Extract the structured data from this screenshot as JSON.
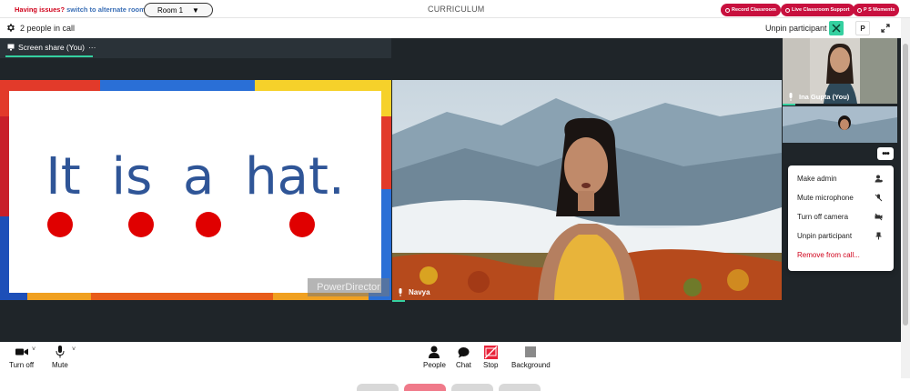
{
  "topbar": {
    "issues_text": "Having issues?",
    "alt_room_link": "switch to alternate room",
    "room_select_value": "Room 1",
    "title": "CURRICULUM",
    "buttons": [
      "Record Classroom",
      "Live Classroom Support",
      "P S Moments"
    ]
  },
  "callbar": {
    "people_count": "2 people in call",
    "unpin_label": "Unpin participant",
    "p_button": "P"
  },
  "screen_share": {
    "tab_label": "Screen share (You)",
    "tab_more": "···",
    "slide_text": "It is a hat.",
    "watermark": "PowerDirector"
  },
  "participants": {
    "main_name": "Navya",
    "self_name": "Ina Gupta (You)"
  },
  "context_menu": {
    "more_button": "•••",
    "items": [
      "Make admin",
      "Mute microphone",
      "Turn off camera",
      "Unpin participant",
      "Remove from call..."
    ]
  },
  "controls": {
    "turn_off": "Turn off",
    "mute": "Mute",
    "people": "People",
    "chat": "Chat",
    "stop": "Stop",
    "background": "Background"
  },
  "colors": {
    "accent_green": "#35d0a0",
    "pill_red": "#c8103e",
    "stage_bg": "#1f2529",
    "slide_text": "#2f5597",
    "dot_red": "#e00000"
  }
}
